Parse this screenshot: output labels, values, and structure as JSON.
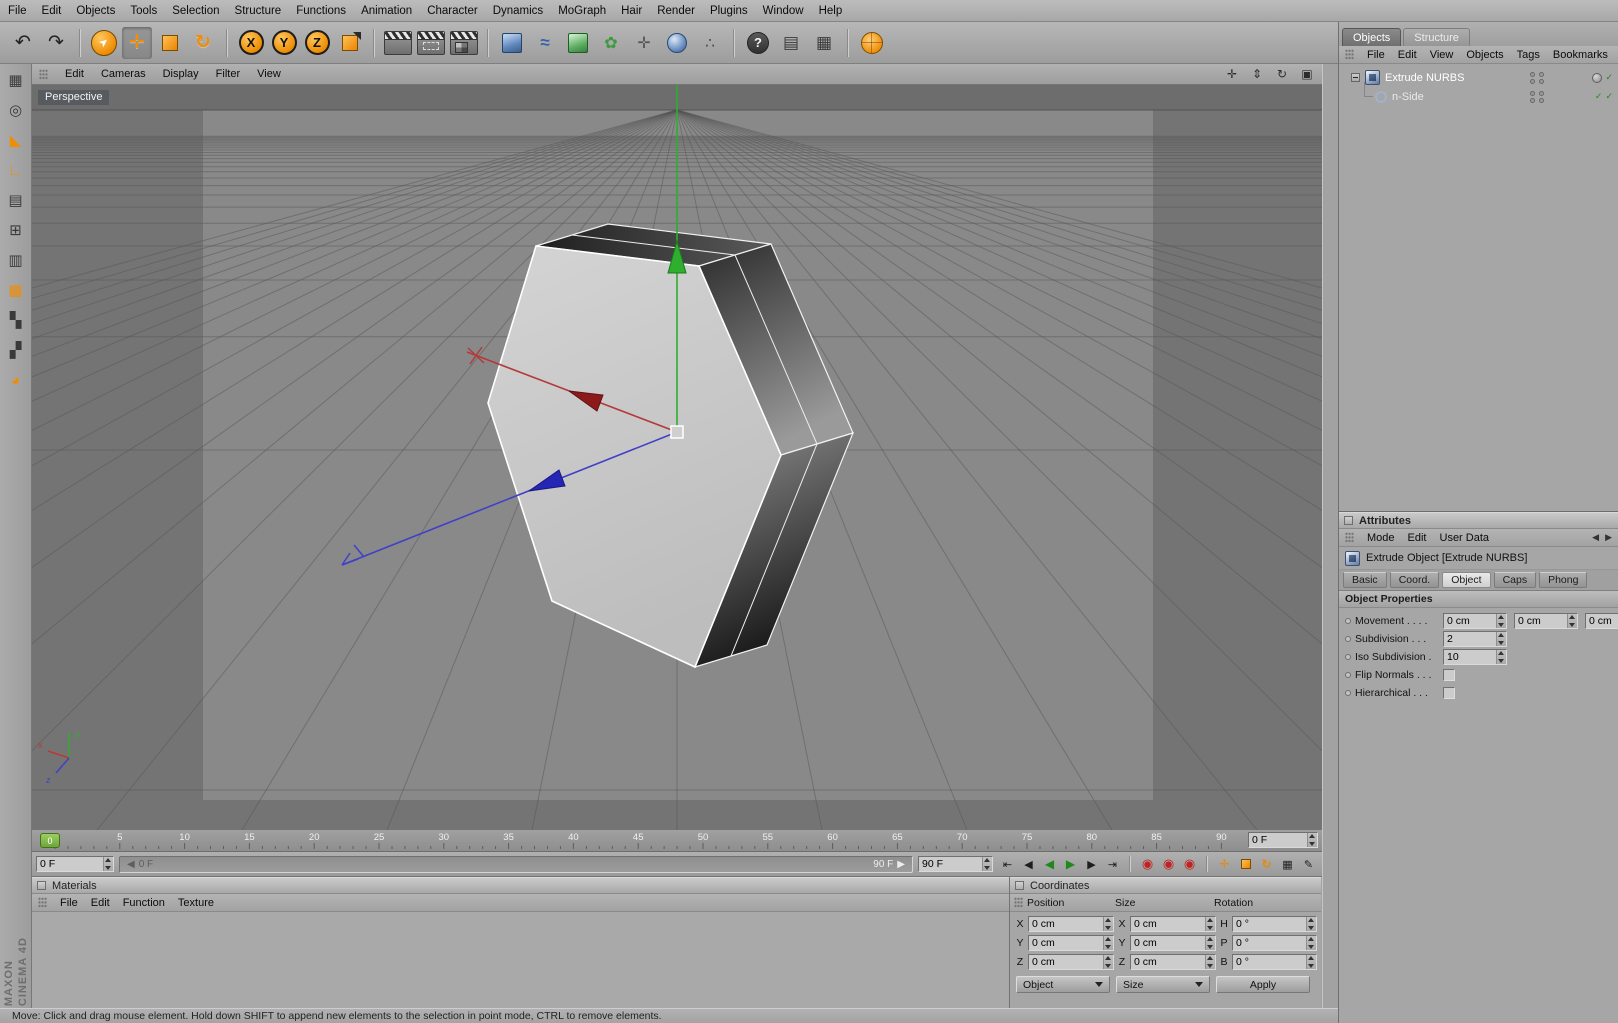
{
  "menubar": {
    "items": [
      "File",
      "Edit",
      "Objects",
      "Tools",
      "Selection",
      "Structure",
      "Functions",
      "Animation",
      "Character",
      "Dynamics",
      "MoGraph",
      "Hair",
      "Render",
      "Plugins",
      "Window",
      "Help"
    ]
  },
  "toolbar_icons": {
    "undo": "↶",
    "redo": "↷",
    "live_selection": "➤",
    "move": "✛",
    "rotate": "↻",
    "lock_x": "X",
    "lock_y": "Y",
    "lock_z": "Z",
    "spline": "≈",
    "modifier": "✿",
    "axes": "✛",
    "particles": "∴",
    "help": "?",
    "selection_filter": "▤",
    "command_palette": "▦"
  },
  "sidebar_icons": {
    "layout": "▦",
    "browser": "◎",
    "snap": "◣",
    "ruler": "∟",
    "array": "▤",
    "grid": "⊞",
    "workplane": "▥",
    "texture": "▩",
    "checker_a": "▚",
    "checker_b": "▞",
    "pie": "◕"
  },
  "viewport": {
    "label": "Perspective",
    "menu": [
      "Edit",
      "Cameras",
      "Display",
      "Filter",
      "View"
    ],
    "pan_icon": "✛",
    "zoom_icon": "⇕",
    "rotate_icon": "↻",
    "maximize_icon": "▣",
    "triad": {
      "x": "x",
      "y": "y",
      "z": "z"
    }
  },
  "timeline": {
    "ticks": [
      "0",
      "5",
      "10",
      "15",
      "20",
      "25",
      "30",
      "35",
      "40",
      "45",
      "50",
      "55",
      "60",
      "65",
      "70",
      "75",
      "80",
      "85",
      "90"
    ],
    "playhead": "0",
    "frame_display": "0 F"
  },
  "transport": {
    "frame_field": "0 F",
    "range_start": "0 F",
    "range_end": "90 F",
    "end_field": "90 F",
    "slider_left_arrow": "◀",
    "slider_right_arrow": "▶",
    "goto_start": "⇤",
    "prev_frame": "◀",
    "play_back": "◀",
    "play": "▶",
    "next_frame": "▶",
    "goto_end": "⇥",
    "record": "◉",
    "autokey": "◉",
    "record_params": "◉",
    "key_position": "✛",
    "key_rotation": "↻",
    "key_param": "▦",
    "key_edit": "✎"
  },
  "materials": {
    "title": "Materials",
    "menu": [
      "File",
      "Edit",
      "Function",
      "Texture"
    ]
  },
  "coordinates": {
    "title": "Coordinates",
    "columns": [
      "Position",
      "Size",
      "Rotation"
    ],
    "pos_labels": [
      "X",
      "Y",
      "Z"
    ],
    "pos_values": [
      "0 cm",
      "0 cm",
      "0 cm"
    ],
    "size_labels": [
      "X",
      "Y",
      "Z"
    ],
    "size_values": [
      "0 cm",
      "0 cm",
      "0 cm"
    ],
    "rot_labels": [
      "H",
      "P",
      "B"
    ],
    "rot_values": [
      "0 °",
      "0 °",
      "0 °"
    ],
    "object_dropdown": "Object",
    "size_dropdown": "Size",
    "apply_button": "Apply"
  },
  "objects_panel": {
    "tabs": [
      {
        "label": "Objects"
      },
      {
        "label": "Structure"
      }
    ],
    "menu": [
      "File",
      "Edit",
      "View",
      "Objects",
      "Tags",
      "Bookmarks"
    ],
    "tree": [
      {
        "label": "Extrude NURBS"
      },
      {
        "label": "n-Side"
      }
    ],
    "check": "✓"
  },
  "attributes": {
    "title": "Attributes",
    "menu": [
      "Mode",
      "Edit",
      "User Data"
    ],
    "nav_left": "◀",
    "nav_right": "▶",
    "object_title": "Extrude Object [Extrude NURBS]",
    "tabs": [
      "Basic",
      "Coord.",
      "Object",
      "Caps",
      "Phong"
    ],
    "section": "Object Properties",
    "properties": {
      "movement_label": "Movement . . . .",
      "movement_x": "0 cm",
      "movement_y": "0 cm",
      "movement_z": "0 cm",
      "subdivision_label": "Subdivision . . .",
      "subdivision": "2",
      "iso_label": "Iso Subdivision .",
      "iso": "10",
      "flip_label": "Flip Normals . . .",
      "hier_label": "Hierarchical . . ."
    }
  },
  "statusbar": {
    "text": "Move: Click and drag mouse element. Hold down SHIFT to append new elements to the selection in point mode, CTRL to remove elements."
  },
  "branding": {
    "line1": "MAXON",
    "line2": "CINEMA 4D"
  }
}
